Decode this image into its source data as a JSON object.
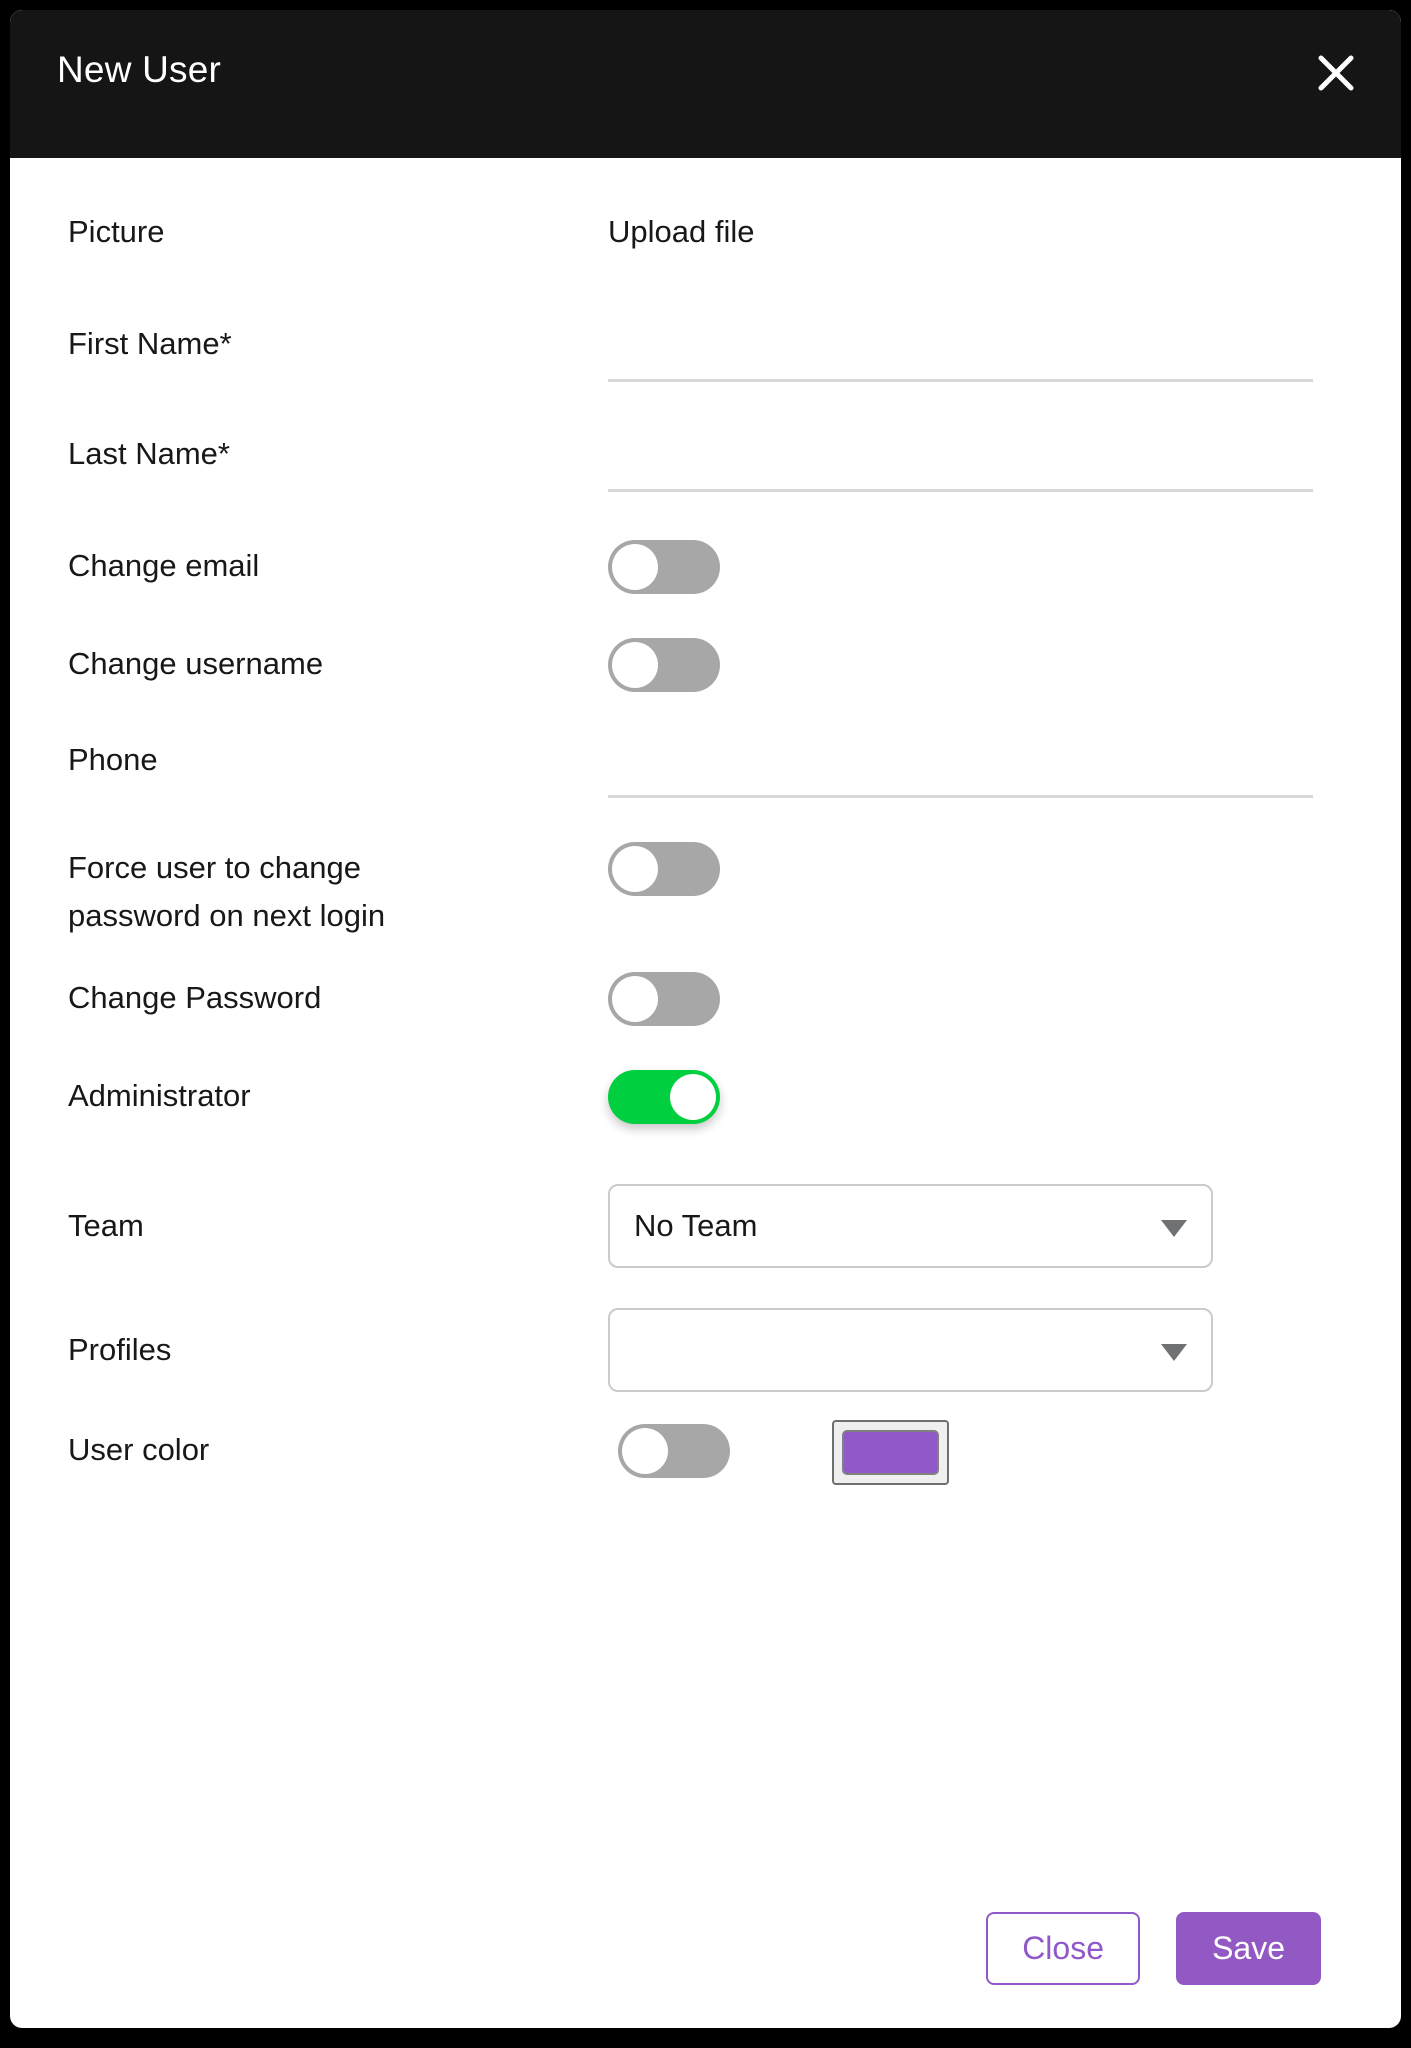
{
  "dialog": {
    "title": "New User",
    "close_icon": "close-icon",
    "accent_purple": "#9259c4",
    "toggle_on_color": "#00cf3f",
    "toggle_off_color": "#a7a7a7",
    "header_bg": "#151515"
  },
  "fields": {
    "picture": {
      "label": "Picture",
      "upload_label": "Upload file"
    },
    "first_name": {
      "label": "First Name*",
      "value": "",
      "placeholder": ""
    },
    "last_name": {
      "label": "Last Name*",
      "value": "",
      "placeholder": ""
    },
    "change_email": {
      "label": "Change email",
      "state": "off"
    },
    "change_username": {
      "label": "Change username",
      "state": "off"
    },
    "phone": {
      "label": "Phone",
      "value": "",
      "placeholder": ""
    },
    "force_password_change": {
      "label": "Force user to change\npassword on next login",
      "state": "off"
    },
    "change_password": {
      "label": "Change Password",
      "state": "off"
    },
    "administrator": {
      "label": "Administrator",
      "state": "on"
    },
    "team": {
      "label": "Team",
      "value": "No Team",
      "caret_icon": "chevron-down-icon"
    },
    "profiles": {
      "label": "Profiles",
      "value": "",
      "caret_icon": "chevron-down-icon"
    },
    "user_color": {
      "label": "User color",
      "state": "off",
      "color": "#9058c8"
    }
  },
  "footer": {
    "close_label": "Close",
    "save_label": "Save"
  }
}
